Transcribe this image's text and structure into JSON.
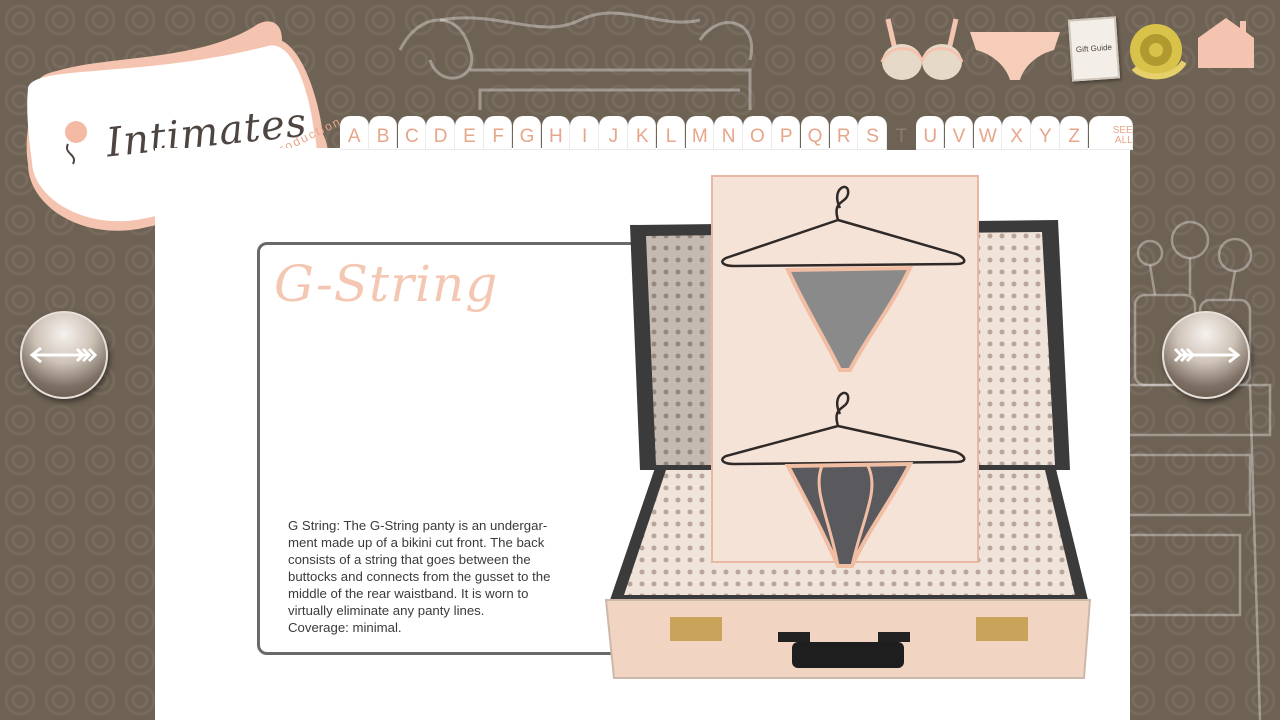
{
  "logo": {
    "title": "Intimates",
    "subtitle": "a brief introduction"
  },
  "top_nav": {
    "icons": [
      "bra-icon",
      "panty-icon",
      "gift-guide-icon",
      "measuring-tape-icon",
      "home-icon"
    ],
    "gift_guide_label": "Gift Guide"
  },
  "alphabet": {
    "letters": [
      "A",
      "B",
      "C",
      "D",
      "E",
      "F",
      "G",
      "H",
      "I",
      "J",
      "K",
      "L",
      "M",
      "N",
      "O",
      "P",
      "Q",
      "R",
      "S",
      "T",
      "U",
      "V",
      "W",
      "X",
      "Y",
      "Z"
    ],
    "active": "T",
    "see_all_line1": "SEE",
    "see_all_line2": "ALL"
  },
  "entry": {
    "title": "G-String",
    "description": "G String:  The G-String panty is an undergar-\nment made up of a bikini cut front.  The back\nconsists of a string that goes between the\nbuttocks and connects from the gusset to the\nmiddle of the rear waistband.  It is worn to\nvirtually eliminate any panty lines.\nCoverage: minimal."
  },
  "colors": {
    "accent": "#e7a58a",
    "background": "#6e6254",
    "title_pink": "#f4c7b2",
    "suitcase_peach": "#f1d4c2"
  }
}
